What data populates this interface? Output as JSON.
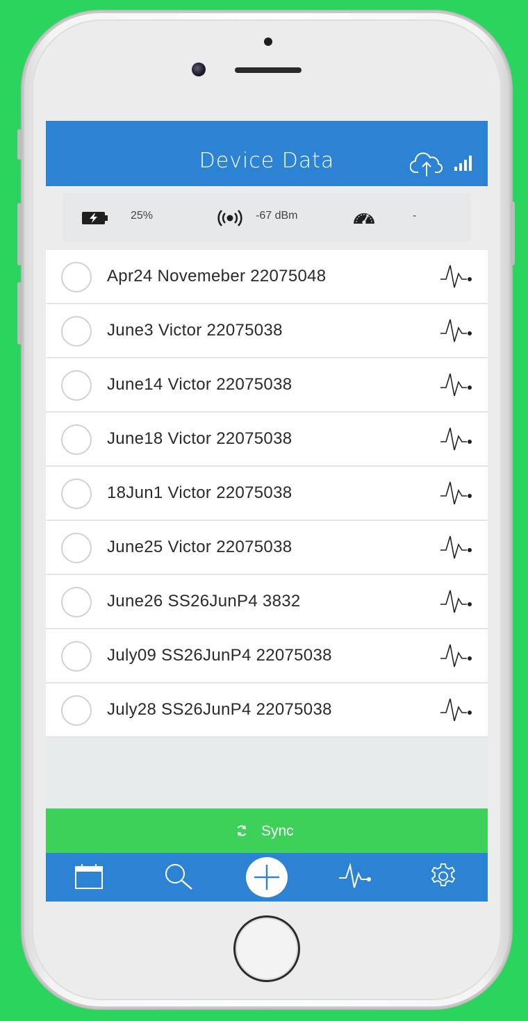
{
  "header": {
    "title": "Device Data"
  },
  "status": {
    "battery": "25%",
    "rssi": "-67 dBm",
    "speed": "-"
  },
  "records": [
    {
      "label": "Apr24 Novemeber 22075048"
    },
    {
      "label": "June3 Victor 22075038"
    },
    {
      "label": "June14 Victor 22075038"
    },
    {
      "label": "June18 Victor 22075038"
    },
    {
      "label": "18Jun1 Victor 22075038"
    },
    {
      "label": "June25 Victor 22075038"
    },
    {
      "label": "June26 SS26JunP4 3832"
    },
    {
      "label": "July09 SS26JunP4 22075038"
    },
    {
      "label": "July28 SS26JunP4 22075038"
    }
  ],
  "sync": {
    "label": "Sync"
  },
  "tabs": [
    "calendar-icon",
    "search-icon",
    "add-icon",
    "pulse-icon",
    "settings-icon"
  ],
  "colors": {
    "primary": "#2d83d3",
    "sync": "#3dd15a",
    "background": "#2bd45c"
  }
}
